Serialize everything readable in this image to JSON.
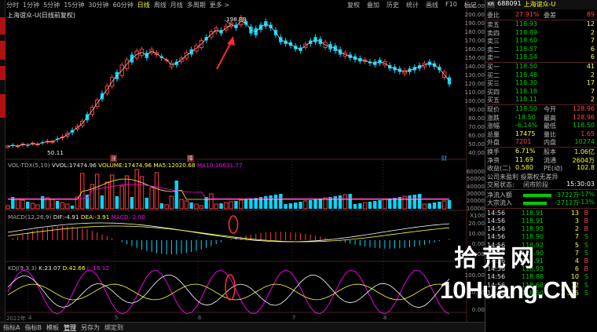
{
  "toolbar": {
    "periods": [
      "分时",
      "1分钟",
      "5分钟",
      "15分钟",
      "30分钟",
      "60分钟",
      "日线",
      "周线",
      "月线",
      "多周期",
      "更多 >"
    ],
    "active_index": 6,
    "right": [
      "复权",
      "叠加",
      "历史",
      "统计",
      "画线",
      "F10",
      "标记",
      "+自选",
      "返回"
    ],
    "close": "×"
  },
  "stock_title": "上海谊众-U(日线前复权)",
  "price_axis": [
    "210.00",
    "200.00",
    "190.00",
    "180.00",
    "170.00",
    "160.00",
    "150.00",
    "140.00",
    "130.00",
    "120.00",
    "110.00",
    "100.00",
    "90.00",
    "80.00",
    "70.00",
    "60.00",
    "50.00",
    "40.00"
  ],
  "price_annotations": {
    "high": "198.88",
    "low": "50.11"
  },
  "event_marks": {
    "zhang": "涨",
    "jiang": "降",
    "cai": "财"
  },
  "volume": {
    "label": "VOL-TDX(5,10)",
    "vvol_label": "VVOL:",
    "vvol": "17474.96",
    "vol_label": "VOLUME:",
    "vol": "17474.96",
    "ma5_label": "MA5:",
    "ma5": "12020.68",
    "ma10_label": "MA10:",
    "ma10": "16631.77",
    "axis": [
      "60000",
      "50000",
      "40000",
      "30000",
      "20000",
      "10000",
      "X100"
    ]
  },
  "macd": {
    "label": "MACD(12,26,9)",
    "dif_label": "DIF:",
    "dif": "-4.91",
    "dea_label": "DEA:",
    "dea": "-3.91",
    "macd_label": "MACD:",
    "macd": "-2.00",
    "axis": [
      "20.00",
      "10.00",
      "0.00",
      "-10.00"
    ]
  },
  "kdj": {
    "label": "KDJ(9,3,3)",
    "k_label": "K:",
    "k": "23.07",
    "d_label": "D:",
    "d": "42.66",
    "j_label": "J:",
    "j": "-16.12",
    "axis": [
      "100.00",
      "50.00",
      "0.00"
    ]
  },
  "date_ticks": [
    "2022年",
    "4",
    "5",
    "6",
    "7",
    "8"
  ],
  "bottom_tabs": [
    "指标A",
    "指标B",
    "模板",
    "管理",
    "另存为",
    "绑定到"
  ],
  "bottom_active": 3,
  "right_panel": {
    "code_tag": "KR",
    "code": "688091",
    "name": "上海谊众-U",
    "weibi_label": "委比",
    "weibi": "27.91%",
    "weicha_label": "委差",
    "weicha": "89",
    "sell": [
      {
        "label": "卖五",
        "price": "118.93",
        "vol": "12"
      },
      {
        "label": "卖四",
        "price": "118.89",
        "vol": "2"
      },
      {
        "label": "卖三",
        "price": "118.60",
        "vol": "7"
      },
      {
        "label": "卖二",
        "price": "118.57",
        "vol": "6"
      },
      {
        "label": "卖一",
        "price": "118.54",
        "vol": "6"
      }
    ],
    "buy": [
      {
        "label": "买一",
        "price": "118.50",
        "vol": "41"
      },
      {
        "label": "买二",
        "price": "118.48",
        "vol": "2"
      },
      {
        "label": "买三",
        "price": "118.30",
        "vol": "17"
      },
      {
        "label": "买四",
        "price": "118.18",
        "vol": "7"
      },
      {
        "label": "买五",
        "price": "118.11",
        "vol": "2"
      }
    ],
    "stats": [
      {
        "l1": "现价",
        "v1": "118.50",
        "l2": "今开",
        "v2": "128.96"
      },
      {
        "l1": "涨跌",
        "v1": "-18.50",
        "l2": "最高",
        "v2": "128.96"
      },
      {
        "l1": "涨幅",
        "v1": "-6.14%",
        "l2": "最低",
        "v2": "118.50"
      },
      {
        "l1": "总量",
        "v1": "17475",
        "l2": "量比",
        "v2": "1.65"
      },
      {
        "l1": "外盘",
        "v1": "7201",
        "l2": "内盘",
        "v2": "10274"
      }
    ],
    "stats2": [
      {
        "l1": "换手",
        "v1": "6.71%",
        "l2": "股本",
        "v2": "1.06亿"
      },
      {
        "l1": "净资",
        "v1": "11.69",
        "l2": "流通",
        "v2": "2604万"
      },
      {
        "l1": "收益(二)",
        "v1": "0.580",
        "l2": "PE(动)",
        "v2": "102.8"
      }
    ],
    "notice": "公司未盈利 投票权无差异",
    "trade_status_label": "交易状态:",
    "trade_status": "闭市阶段",
    "trade_time": "15:30:03",
    "flow": [
      {
        "label": "净流入额",
        "value": "-3722万",
        "pct": "-17%",
        "ratio": 0.6
      },
      {
        "label": "大宗流入",
        "value": "-2712万",
        "pct": "-13%",
        "ratio": 0.45
      }
    ],
    "ticks": [
      {
        "t": "14:56",
        "p": "118.91",
        "v": "13",
        "s": "B"
      },
      {
        "t": "14:56",
        "p": "118.91",
        "v": "3",
        "s": "B"
      },
      {
        "t": "14:56",
        "p": "118.93",
        "v": "2",
        "s": "B"
      },
      {
        "t": "14:56",
        "p": "118.90",
        "v": "7",
        "s": "S"
      },
      {
        "t": "14:56",
        "p": "118.92",
        "v": "5",
        "s": "S"
      },
      {
        "t": "14:56",
        "p": "118.90",
        "v": "7",
        "s": "S"
      },
      {
        "t": "14:56",
        "p": "118.91",
        "v": "4",
        "s": "B"
      },
      {
        "t": "14:56",
        "p": "118.93",
        "v": "6",
        "s": "B"
      },
      {
        "t": "14:56",
        "p": "118.88",
        "v": "10",
        "s": "S"
      },
      {
        "t": "14:56",
        "p": "118.68",
        "v": "12",
        "s": "S"
      },
      {
        "t": "15:00",
        "p": "118.50",
        "v": "335",
        "s": "S"
      }
    ]
  },
  "watermark": {
    "cn": "拾荒网",
    "en": "10Huang.CN"
  },
  "colors": {
    "up": "#ff3b3b",
    "down": "#00d8ff",
    "ma": "#ffffff",
    "accent_yellow": "#ffff33",
    "accent_magenta": "#ff00ff"
  }
}
